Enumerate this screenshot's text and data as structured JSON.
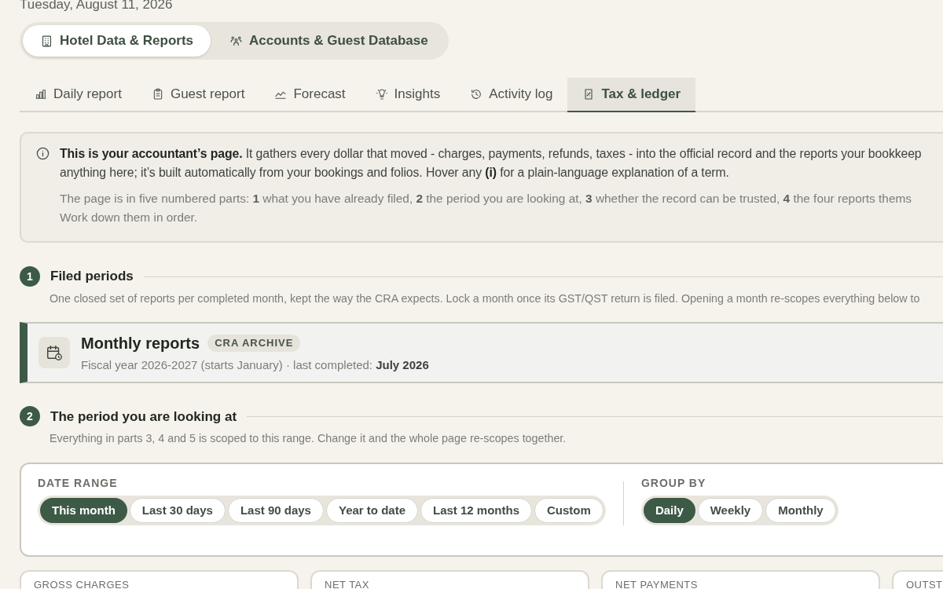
{
  "date": "Tuesday, August 11, 2026",
  "workspace_tabs": [
    {
      "label": "Hotel Data & Reports",
      "selected": true
    },
    {
      "label": "Accounts & Guest Database",
      "selected": false
    }
  ],
  "tabs": [
    {
      "label": "Daily report",
      "selected": false
    },
    {
      "label": "Guest report",
      "selected": false
    },
    {
      "label": "Forecast",
      "selected": false
    },
    {
      "label": "Insights",
      "selected": false
    },
    {
      "label": "Activity log",
      "selected": false
    },
    {
      "label": "Tax & ledger",
      "selected": true
    }
  ],
  "info": {
    "lines": [
      "**This is your accountant’s page.** It gathers every dollar that moved - charges, payments, refunds, taxes - into the official record and the reports your bookkeep",
      "anything here; it’s built automatically from your bookings and folios. Hover any **(i)** for a plain-language explanation of a term."
    ],
    "note_lines": [
      "The page is in five numbered parts: **1** what you have already filed, **2** the period you are looking at, **3** whether the record can be trusted, **4** the four reports thems",
      "Work down them in order."
    ]
  },
  "sections": [
    {
      "number": "1",
      "title": "Filed periods",
      "description": "One closed set of reports per completed month, kept the way the CRA expects. Lock a month once its GST/QST return is filed. Opening a month re-scopes everything below to"
    },
    {
      "number": "2",
      "title": "The period you are looking at",
      "description": "Everything in parts 3, 4 and 5 is scoped to this range. Change it and the whole page re-scopes together."
    }
  ],
  "archive": {
    "title": "Monthly reports",
    "badge": "CRA ARCHIVE",
    "subtitle": "Fiscal year 2026-2027 (starts January) · last completed: **July 2026**"
  },
  "date_range": {
    "label": "DATE RANGE",
    "options": [
      {
        "label": "This month",
        "selected": true
      },
      {
        "label": "Last 30 days",
        "selected": false
      },
      {
        "label": "Last 90 days",
        "selected": false
      },
      {
        "label": "Year to date",
        "selected": false
      },
      {
        "label": "Last 12 months",
        "selected": false
      },
      {
        "label": "Custom",
        "selected": false
      }
    ]
  },
  "group_by": {
    "label": "GROUP BY",
    "options": [
      {
        "label": "Daily",
        "selected": true
      },
      {
        "label": "Weekly",
        "selected": false
      },
      {
        "label": "Monthly",
        "selected": false
      }
    ]
  },
  "summary_cards": [
    {
      "label": "GROSS CHARGES"
    },
    {
      "label": "NET TAX"
    },
    {
      "label": "NET PAYMENTS"
    },
    {
      "label": "OUTST"
    }
  ]
}
